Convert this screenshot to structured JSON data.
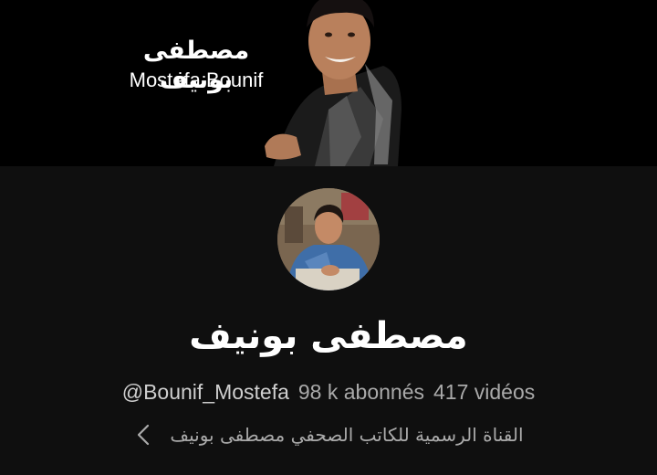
{
  "banner": {
    "title_ar": "مصطفى بونيف",
    "title_en": "Mostefa Bounif"
  },
  "channel": {
    "name": "مصطفى بونيف",
    "handle": "@Bounif_Mostefa",
    "subscribers": "98 k abonnés",
    "videos": "417 vidéos",
    "description": "القناة الرسمية للكاتب الصحفي مصطفى بونيف"
  },
  "icons": {
    "description_more": "chevron-left-icon"
  },
  "colors": {
    "background": "#0f0f0f",
    "banner_background": "#000000",
    "primary_text": "#ffffff",
    "secondary_text": "#aaaaaa"
  }
}
